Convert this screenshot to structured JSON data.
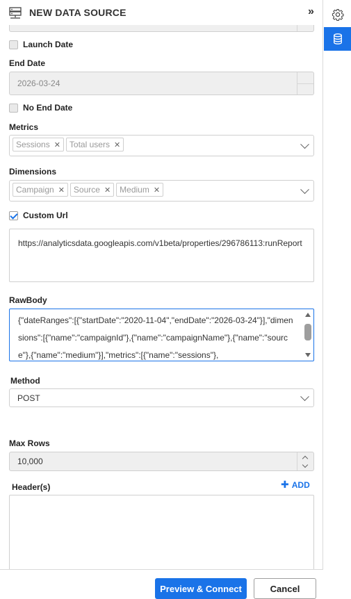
{
  "header": {
    "title": "NEW DATA SOURCE",
    "collapse_icon": "double-chevron-right-icon"
  },
  "rail": {
    "settings_icon": "gear-icon",
    "datasource_icon": "database-icon",
    "accent": "#1a73e8"
  },
  "form": {
    "launch_date": {
      "label": "Launch Date",
      "checked": false
    },
    "end_date": {
      "label": "End Date",
      "value": "2026-03-24"
    },
    "no_end_date": {
      "label": "No End Date",
      "checked": false
    },
    "metrics": {
      "label": "Metrics",
      "tags": [
        "Sessions",
        "Total users"
      ]
    },
    "dimensions": {
      "label": "Dimensions",
      "tags": [
        "Campaign",
        "Source",
        "Medium"
      ]
    },
    "custom_url": {
      "label": "Custom Url",
      "checked": true,
      "value": "https://analyticsdata.googleapis.com/v1beta/properties/296786113:runReport"
    },
    "raw_body": {
      "label": "RawBody",
      "value": "{\"dateRanges\":[{\"startDate\":\"2020-11-04\",\"endDate\":\"2026-03-24\"}],\"dimensions\":[{\"name\":\"campaignId\"},{\"name\":\"campaignName\"},{\"name\":\"source\"},{\"name\":\"medium\"}],\"metrics\":[{\"name\":\"sessions\"},"
    },
    "method": {
      "label": "Method",
      "value": "POST"
    },
    "max_rows": {
      "label": "Max Rows",
      "value": "10,000"
    },
    "headers": {
      "label": "Header(s)",
      "add_label": "ADD"
    }
  },
  "footer": {
    "preview_label": "Preview & Connect",
    "cancel_label": "Cancel"
  }
}
